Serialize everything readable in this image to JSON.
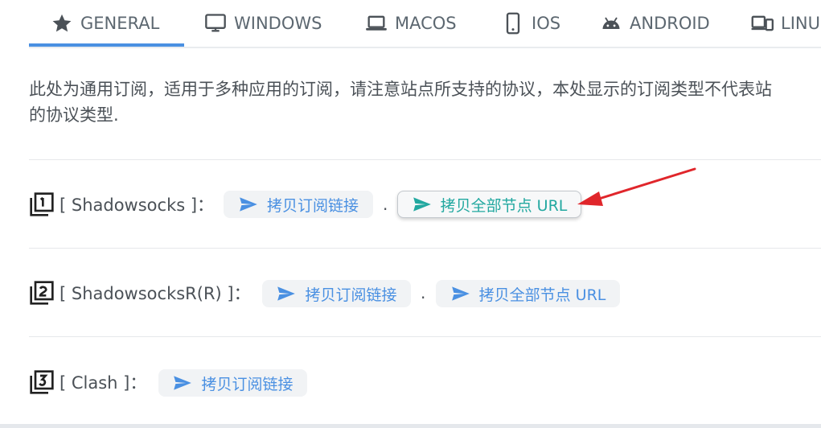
{
  "tabs": [
    {
      "label": "GENERAL",
      "icon": "star-icon",
      "active": true
    },
    {
      "label": "WINDOWS",
      "icon": "monitor-icon",
      "active": false
    },
    {
      "label": "MACOS",
      "icon": "laptop-icon",
      "active": false
    },
    {
      "label": "IOS",
      "icon": "phone-icon",
      "active": false
    },
    {
      "label": "ANDROID",
      "icon": "android-icon",
      "active": false
    },
    {
      "label": "LINU",
      "icon": "devices-icon",
      "active": false
    }
  ],
  "description": {
    "line1": "此处为通用订阅，适用于多种应用的订阅，请注意站点所支持的协议，本处显示的订阅类型不代表站",
    "line2": "的协议类型."
  },
  "rows": [
    {
      "label": "[ Shadowsocks ]：",
      "copy_sub": "拷贝订阅链接",
      "separator": ".",
      "copy_all": "拷贝全部节点 URL"
    },
    {
      "label": "[ ShadowsocksR(R) ]：",
      "copy_sub": "拷贝订阅链接",
      "separator": ".",
      "copy_all": "拷贝全部节点 URL"
    },
    {
      "label": "[ Clash ]：",
      "copy_sub": "拷贝订阅链接"
    }
  ],
  "colors": {
    "accent": "#4a90e2",
    "highlight_text": "#22a8a0",
    "annotation_arrow": "#e0262b"
  }
}
